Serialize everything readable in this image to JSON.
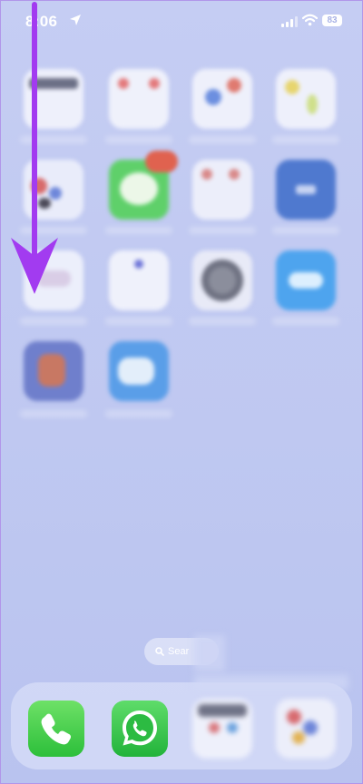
{
  "status_bar": {
    "time": "8:06",
    "battery": "83",
    "icons": [
      "location-arrow-icon",
      "signal-bars-icon",
      "wifi-icon",
      "battery-icon"
    ]
  },
  "home_screen": {
    "search_label": "Sear"
  },
  "dock": {
    "apps": [
      {
        "name": "phone-icon"
      },
      {
        "name": "whatsapp-icon"
      }
    ]
  },
  "colors": {
    "wallpaper": "#c5cdf3",
    "annotation_arrow": "#a23bf0",
    "phone_green": "#34c759",
    "whatsapp_green": "#25d366"
  }
}
